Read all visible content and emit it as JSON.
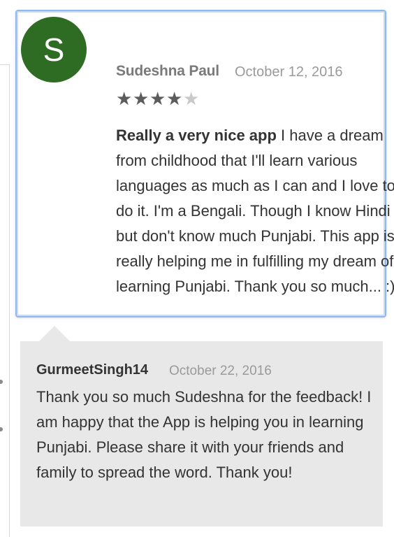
{
  "review": {
    "avatar_letter": "S",
    "reviewer_name": "Sudeshna Paul",
    "date": "October 12, 2016",
    "rating": 4,
    "rating_max": 5,
    "title": "Really a very nice app",
    "text": " I have a dream from childhood that I'll learn various languages as much as I can and I love to do it. I'm a Bengali. Though I know Hindi but don't know much Punjabi. This app is really helping me in fulfilling my dream of learning Punjabi. Thank you so much... :)"
  },
  "reply": {
    "author": "GurmeetSingh14",
    "date": "October 22, 2016",
    "text": "Thank you so much Sudeshna for the feedback! I am happy that the App is helping you in learning Punjabi. Please share it with your friends and family to spread the word. Thank you!"
  },
  "colors": {
    "avatar_bg": "#2e6b23",
    "card_border": "#8fb8f0",
    "reply_bg": "#e8e8e8"
  }
}
